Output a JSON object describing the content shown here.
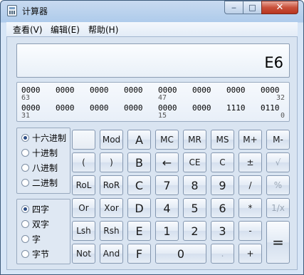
{
  "window": {
    "title": "计算器",
    "minimize": "‒",
    "maximize": "□",
    "close": "✕"
  },
  "menu": [
    "查看(V)",
    "编辑(E)",
    "帮助(H)"
  ],
  "display": {
    "value": "E6"
  },
  "bits": {
    "row1": [
      "0000",
      "0000",
      "0000",
      "0000",
      "0000",
      "0000",
      "0000",
      "0000"
    ],
    "row1_index": [
      "63",
      "47",
      "32"
    ],
    "row2": [
      "0000",
      "0000",
      "0000",
      "0000",
      "0000",
      "0000",
      "1110",
      "0110"
    ],
    "row2_index": [
      "31",
      "15",
      "0"
    ]
  },
  "radix": {
    "options": [
      "十六进制",
      "十进制",
      "八进制",
      "二进制"
    ],
    "selected": "十六进制"
  },
  "word": {
    "options": [
      "四字",
      "双字",
      "字",
      "字节"
    ],
    "selected": "四字"
  },
  "keys": {
    "r1": [
      "",
      "Mod",
      "A",
      "MC",
      "MR",
      "MS",
      "M+",
      "M-"
    ],
    "r2": [
      "(",
      ")",
      "B",
      "←",
      "CE",
      "C",
      "±",
      "√"
    ],
    "r3": [
      "RoL",
      "RoR",
      "C",
      "7",
      "8",
      "9",
      "/",
      "%"
    ],
    "r4": [
      "Or",
      "Xor",
      "D",
      "4",
      "5",
      "6",
      "*",
      "1/x"
    ],
    "r5": [
      "Lsh",
      "Rsh",
      "E",
      "1",
      "2",
      "3",
      "-",
      "="
    ],
    "r6": [
      "Not",
      "And",
      "F",
      "0",
      ".",
      "+"
    ]
  }
}
